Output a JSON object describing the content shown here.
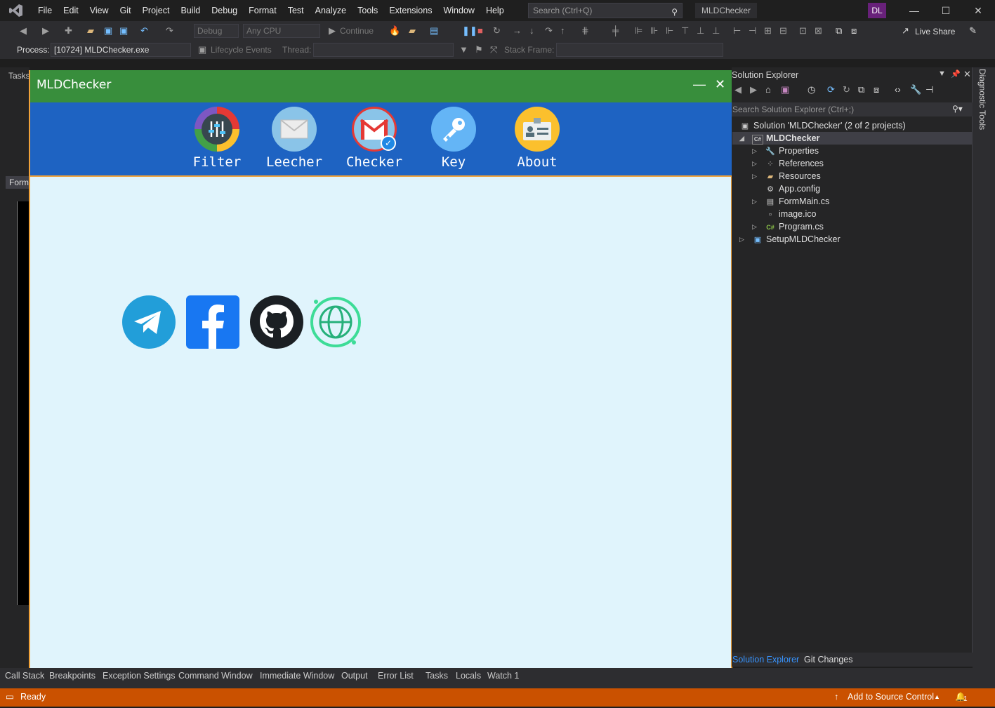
{
  "menubar": {
    "items": [
      "File",
      "Edit",
      "View",
      "Git",
      "Project",
      "Build",
      "Debug",
      "Format",
      "Test",
      "Analyze",
      "Tools",
      "Extensions",
      "Window",
      "Help"
    ],
    "search_placeholder": "Search (Ctrl+Q)",
    "solution_title": "MLDChecker",
    "user_initials": "DL"
  },
  "toolbar": {
    "config": "Debug",
    "platform": "Any CPU",
    "continue_label": "Continue",
    "live_share": "Live Share",
    "process_label": "Process:",
    "process_value": "[10724] MLDChecker.exe",
    "lifecycle_label": "Lifecycle Events",
    "thread_label": "Thread:",
    "stack_frame_label": "Stack Frame:"
  },
  "left_dock": {
    "tasks_label": "Tasks",
    "form_tab": "Form"
  },
  "app": {
    "title": "MLDChecker",
    "minimize": "—",
    "close": "✕",
    "nav": [
      {
        "label": "Filter"
      },
      {
        "label": "Leecher"
      },
      {
        "label": "Checker"
      },
      {
        "label": "Key"
      },
      {
        "label": "About"
      }
    ],
    "social": [
      "telegram",
      "facebook",
      "github",
      "website"
    ],
    "colors": {
      "title_bar": "#388e3c",
      "nav_bar": "#1e63c2",
      "content_bg": "#e0f4fc",
      "border": "#f0a23a"
    }
  },
  "solution_explorer": {
    "title": "Solution Explorer",
    "search_placeholder": "Search Solution Explorer (Ctrl+;)",
    "solution": "Solution 'MLDChecker' (2 of 2 projects)",
    "project": "MLDChecker",
    "items": [
      "Properties",
      "References",
      "Resources",
      "App.config",
      "FormMain.cs",
      "image.ico",
      "Program.cs"
    ],
    "setup_project": "SetupMLDChecker",
    "tabs": [
      "Solution Explorer",
      "Git Changes"
    ]
  },
  "diagnostic_tools": "Diagnostic Tools",
  "bottom_tabs": [
    "Call Stack",
    "Breakpoints",
    "Exception Settings",
    "Command Window",
    "Immediate Window",
    "Output",
    "Error List",
    "Tasks",
    "Locals",
    "Watch 1"
  ],
  "status": {
    "ready": "Ready",
    "source_control": "Add to Source Control",
    "notifications": "1"
  }
}
